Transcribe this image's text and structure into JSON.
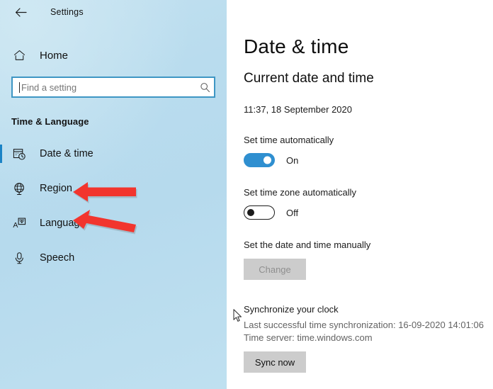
{
  "window": {
    "title": "Settings",
    "back_icon": "back-arrow-icon"
  },
  "sidebar": {
    "home": {
      "label": "Home",
      "icon": "home-icon"
    },
    "search": {
      "value": "",
      "placeholder": "Find a setting",
      "icon": "search-icon"
    },
    "group_title": "Time & Language",
    "items": [
      {
        "label": "Date & time",
        "icon": "calendar-clock-icon",
        "selected": true
      },
      {
        "label": "Region",
        "icon": "globe-icon",
        "selected": false
      },
      {
        "label": "Language",
        "icon": "language-icon",
        "selected": false
      },
      {
        "label": "Speech",
        "icon": "microphone-icon",
        "selected": false
      }
    ],
    "accent_color": "#1b83c6"
  },
  "main": {
    "page_title": "Date & time",
    "section_title": "Current date and time",
    "current_datetime": "11:37, 18 September 2020",
    "set_time_auto": {
      "label": "Set time automatically",
      "state": "On",
      "on": true
    },
    "set_timezone_auto": {
      "label": "Set time zone automatically",
      "state": "Off",
      "on": false
    },
    "manual": {
      "label": "Set the date and time manually",
      "change_button": "Change",
      "change_disabled": true
    },
    "sync": {
      "title": "Synchronize your clock",
      "last_sync": "Last successful time synchronization: 16-09-2020 14:01:06",
      "time_server": "Time server: time.windows.com",
      "sync_button": "Sync now"
    }
  },
  "annotations": {
    "arrow_color": "#f2352e",
    "arrows": [
      {
        "name": "arrow-pointing-region",
        "target": "Region"
      },
      {
        "name": "arrow-pointing-language",
        "target": "Language"
      }
    ],
    "cursor": {
      "name": "mouse-cursor"
    }
  }
}
